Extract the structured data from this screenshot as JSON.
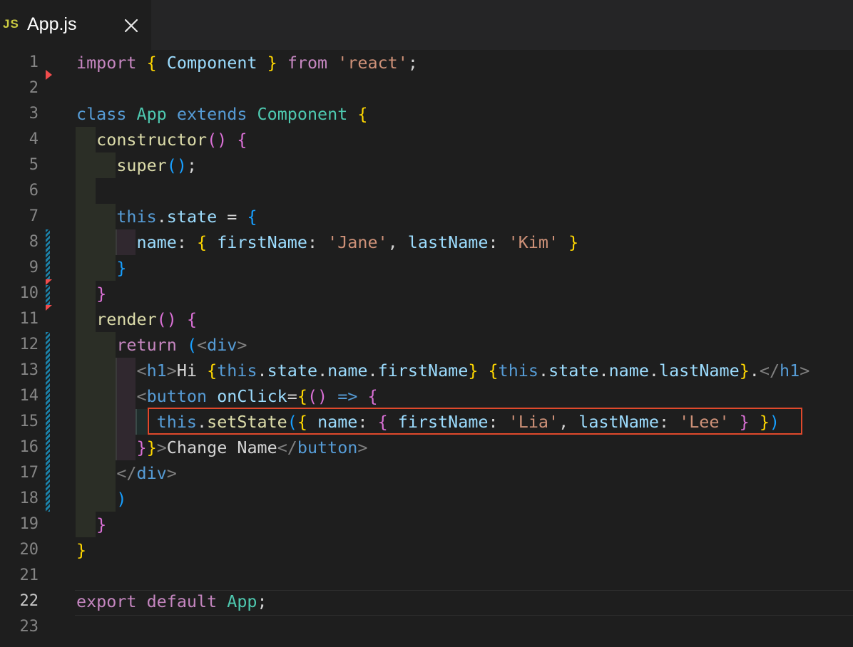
{
  "tab": {
    "icon_label": "JS",
    "title": "App.js",
    "close_icon": "close-icon"
  },
  "editor": {
    "active_line": 22,
    "lines": [
      {
        "n": "1",
        "tokens": [
          [
            "import",
            "kw"
          ],
          [
            " ",
            "p"
          ],
          [
            "{",
            "b1"
          ],
          [
            " ",
            "p"
          ],
          [
            "Component",
            "var"
          ],
          [
            " ",
            "p"
          ],
          [
            "}",
            "b1"
          ],
          [
            " ",
            "p"
          ],
          [
            "from",
            "kw"
          ],
          [
            " ",
            "p"
          ],
          [
            "'react'",
            "str"
          ],
          [
            ";",
            "p"
          ]
        ]
      },
      {
        "n": "2",
        "tokens": []
      },
      {
        "n": "3",
        "tokens": [
          [
            "class",
            "kb"
          ],
          [
            " ",
            "p"
          ],
          [
            "App",
            "cls"
          ],
          [
            " ",
            "p"
          ],
          [
            "extends",
            "kb"
          ],
          [
            " ",
            "p"
          ],
          [
            "Component",
            "cls"
          ],
          [
            " ",
            "p"
          ],
          [
            "{",
            "b1"
          ]
        ]
      },
      {
        "n": "4",
        "tokens": [
          [
            "  ",
            "p"
          ],
          [
            "constructor",
            "fn"
          ],
          [
            "()",
            "b2"
          ],
          [
            " ",
            "p"
          ],
          [
            "{",
            "b2"
          ]
        ]
      },
      {
        "n": "5",
        "tokens": [
          [
            "    ",
            "p"
          ],
          [
            "super",
            "fn"
          ],
          [
            "()",
            "b3"
          ],
          [
            ";",
            "p"
          ]
        ]
      },
      {
        "n": "6",
        "tokens": []
      },
      {
        "n": "7",
        "tokens": [
          [
            "    ",
            "p"
          ],
          [
            "this",
            "kb"
          ],
          [
            ".",
            "p"
          ],
          [
            "state",
            "var"
          ],
          [
            " = ",
            "p"
          ],
          [
            "{",
            "b3"
          ]
        ]
      },
      {
        "n": "8",
        "tokens": [
          [
            "      ",
            "p"
          ],
          [
            "name",
            "var"
          ],
          [
            ": ",
            "p"
          ],
          [
            "{",
            "b1"
          ],
          [
            " ",
            "p"
          ],
          [
            "firstName",
            "var"
          ],
          [
            ": ",
            "p"
          ],
          [
            "'Jane'",
            "str"
          ],
          [
            ", ",
            "p"
          ],
          [
            "lastName",
            "var"
          ],
          [
            ": ",
            "p"
          ],
          [
            "'Kim'",
            "str"
          ],
          [
            " ",
            "p"
          ],
          [
            "}",
            "b1"
          ]
        ]
      },
      {
        "n": "9",
        "tokens": [
          [
            "    ",
            "p"
          ],
          [
            "}",
            "b3"
          ]
        ]
      },
      {
        "n": "10",
        "tokens": [
          [
            "  ",
            "p"
          ],
          [
            "}",
            "b2"
          ]
        ]
      },
      {
        "n": "11",
        "tokens": [
          [
            "  ",
            "p"
          ],
          [
            "render",
            "fn"
          ],
          [
            "()",
            "b2"
          ],
          [
            " ",
            "p"
          ],
          [
            "{",
            "b2"
          ]
        ]
      },
      {
        "n": "12",
        "tokens": [
          [
            "    ",
            "p"
          ],
          [
            "return",
            "kw"
          ],
          [
            " ",
            "p"
          ],
          [
            "(",
            "b3"
          ],
          [
            "<",
            "ang"
          ],
          [
            "div",
            "tag"
          ],
          [
            ">",
            "ang"
          ]
        ]
      },
      {
        "n": "13",
        "tokens": [
          [
            "      ",
            "p"
          ],
          [
            "<",
            "ang"
          ],
          [
            "h1",
            "tag"
          ],
          [
            ">",
            "ang"
          ],
          [
            "Hi ",
            "p"
          ],
          [
            "{",
            "b1"
          ],
          [
            "this",
            "kb"
          ],
          [
            ".",
            "p"
          ],
          [
            "state",
            "var"
          ],
          [
            ".",
            "p"
          ],
          [
            "name",
            "var"
          ],
          [
            ".",
            "p"
          ],
          [
            "firstName",
            "var"
          ],
          [
            "}",
            "b1"
          ],
          [
            " ",
            "p"
          ],
          [
            "{",
            "b1"
          ],
          [
            "this",
            "kb"
          ],
          [
            ".",
            "p"
          ],
          [
            "state",
            "var"
          ],
          [
            ".",
            "p"
          ],
          [
            "name",
            "var"
          ],
          [
            ".",
            "p"
          ],
          [
            "lastName",
            "var"
          ],
          [
            "}",
            "b1"
          ],
          [
            ".",
            "p"
          ],
          [
            "</",
            "ang"
          ],
          [
            "h1",
            "tag"
          ],
          [
            ">",
            "ang"
          ]
        ]
      },
      {
        "n": "14",
        "tokens": [
          [
            "      ",
            "p"
          ],
          [
            "<",
            "ang"
          ],
          [
            "button",
            "tag"
          ],
          [
            " ",
            "p"
          ],
          [
            "onClick",
            "var"
          ],
          [
            "=",
            "p"
          ],
          [
            "{",
            "b1"
          ],
          [
            "()",
            "b2"
          ],
          [
            " ",
            "p"
          ],
          [
            "=>",
            "kb"
          ],
          [
            " ",
            "p"
          ],
          [
            "{",
            "b2"
          ]
        ]
      },
      {
        "n": "15",
        "tokens": [
          [
            "        ",
            "p"
          ],
          [
            "this",
            "kb"
          ],
          [
            ".",
            "p"
          ],
          [
            "setState",
            "fn"
          ],
          [
            "(",
            "b3"
          ],
          [
            "{",
            "b1"
          ],
          [
            " ",
            "p"
          ],
          [
            "name",
            "var"
          ],
          [
            ": ",
            "p"
          ],
          [
            "{",
            "b2"
          ],
          [
            " ",
            "p"
          ],
          [
            "firstName",
            "var"
          ],
          [
            ": ",
            "p"
          ],
          [
            "'Lia'",
            "str"
          ],
          [
            ", ",
            "p"
          ],
          [
            "lastName",
            "var"
          ],
          [
            ": ",
            "p"
          ],
          [
            "'Lee'",
            "str"
          ],
          [
            " ",
            "p"
          ],
          [
            "}",
            "b2"
          ],
          [
            " ",
            "p"
          ],
          [
            "}",
            "b1"
          ],
          [
            ")",
            "b3"
          ]
        ]
      },
      {
        "n": "16",
        "tokens": [
          [
            "      ",
            "p"
          ],
          [
            "}",
            "b2"
          ],
          [
            "}",
            "b1"
          ],
          [
            ">",
            "ang"
          ],
          [
            "Change Name",
            "p"
          ],
          [
            "</",
            "ang"
          ],
          [
            "button",
            "tag"
          ],
          [
            ">",
            "ang"
          ]
        ]
      },
      {
        "n": "17",
        "tokens": [
          [
            "    ",
            "p"
          ],
          [
            "</",
            "ang"
          ],
          [
            "div",
            "tag"
          ],
          [
            ">",
            "ang"
          ]
        ]
      },
      {
        "n": "18",
        "tokens": [
          [
            "    ",
            "p"
          ],
          [
            ")",
            "b3"
          ]
        ]
      },
      {
        "n": "19",
        "tokens": [
          [
            "  ",
            "p"
          ],
          [
            "}",
            "b2"
          ]
        ]
      },
      {
        "n": "20",
        "tokens": [
          [
            "}",
            "b1"
          ]
        ]
      },
      {
        "n": "21",
        "tokens": []
      },
      {
        "n": "22",
        "tokens": [
          [
            "export",
            "kw"
          ],
          [
            " ",
            "p"
          ],
          [
            "default",
            "kw"
          ],
          [
            " ",
            "p"
          ],
          [
            "App",
            "cls"
          ],
          [
            ";",
            "p"
          ]
        ]
      },
      {
        "n": "23",
        "tokens": []
      }
    ]
  }
}
